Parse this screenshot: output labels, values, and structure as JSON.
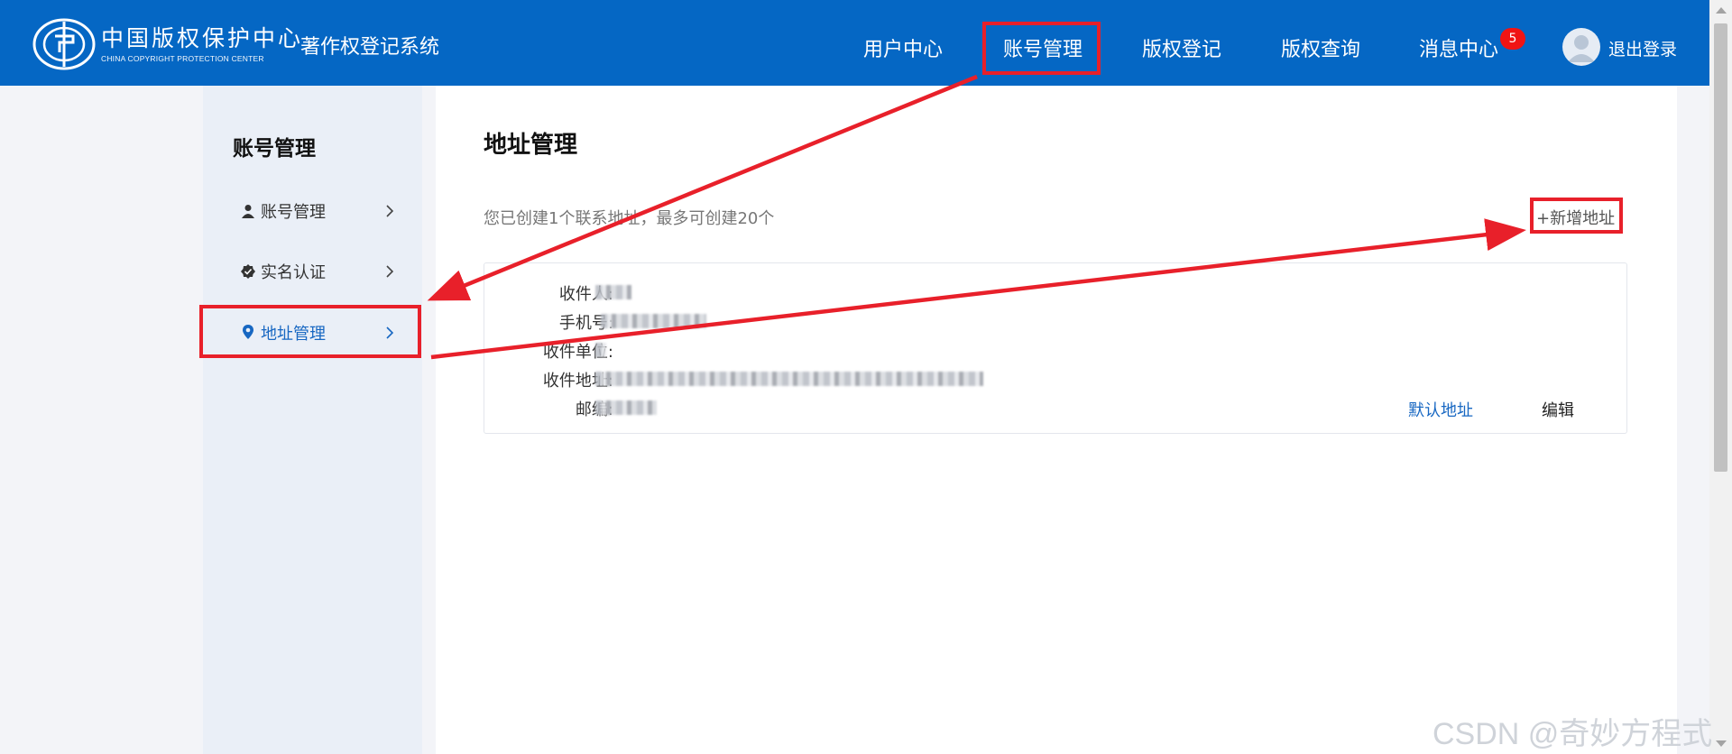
{
  "header": {
    "logo_cn": "中国版权保护中心",
    "logo_en": "CHINA COPYRIGHT PROTECTION CENTER",
    "system_name": "著作权登记系统",
    "nav": [
      {
        "label": "用户中心"
      },
      {
        "label": "账号管理"
      },
      {
        "label": "版权登记"
      },
      {
        "label": "版权查询"
      },
      {
        "label": "消息中心"
      }
    ],
    "badge_count": "5",
    "logout_label": "退出登录",
    "bg_color": "#0567c4"
  },
  "sidebar": {
    "title": "账号管理",
    "items": [
      {
        "label": "账号管理",
        "icon": "user-icon"
      },
      {
        "label": "实名认证",
        "icon": "verified-badge-icon"
      },
      {
        "label": "地址管理",
        "icon": "location-pin-icon",
        "active": true
      }
    ],
    "active_color": "#1767c2"
  },
  "main": {
    "title": "地址管理",
    "hint": "您已创建1个联系地址，最多可创建20个",
    "add_button": "+新增地址",
    "card": {
      "fields": [
        {
          "label": "收件人:"
        },
        {
          "label": "手机号:"
        },
        {
          "label": "收件单位:"
        },
        {
          "label": "收件地址:"
        },
        {
          "label": "邮编:"
        }
      ],
      "default_link": "默认地址",
      "edit_link": "编辑"
    }
  },
  "annotation": {
    "highlight_color": "#e8202a"
  },
  "watermark": "CSDN @奇妙方程式"
}
